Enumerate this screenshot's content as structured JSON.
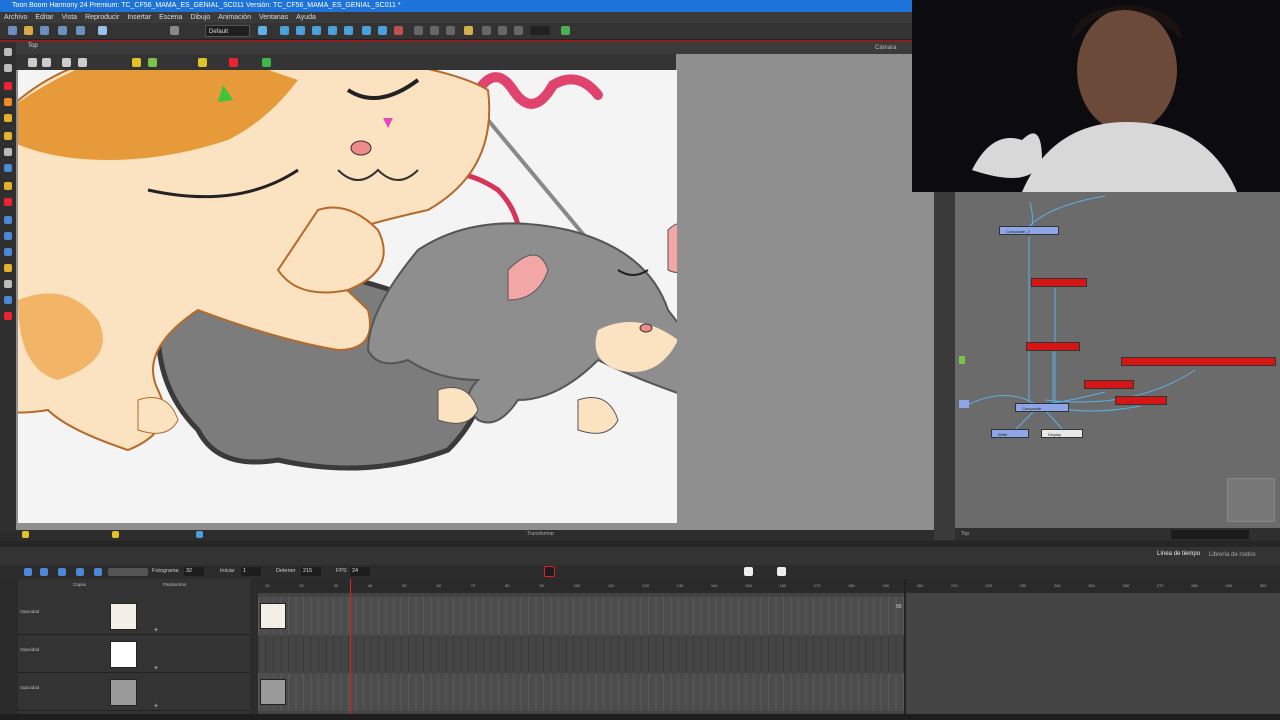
{
  "window": {
    "title": "Toon Boom Harmony 24 Premium: TC_CF56_MAMA_ES_GENIAL_SC011 Versión: TC_CF56_MAMA_ES_GENIAL_SC011 *"
  },
  "menu": [
    "Archivo",
    "Editar",
    "Vista",
    "Reproducir",
    "Insertar",
    "Escena",
    "Dibujo",
    "Animación",
    "Ventanas",
    "Ayuda"
  ],
  "toolbar": {
    "preset": "Default"
  },
  "viewport": {
    "tab": "Top",
    "camera_label": "Cámara",
    "status": "Transformar"
  },
  "nodes": {
    "composite_2": "Composite_2",
    "composite": "Composite",
    "write": "Write",
    "display": "Display"
  },
  "node_footer": "Top",
  "timeline": {
    "tab_timeline": "Línea de tiempo",
    "tab_nodelib": "Librería de nodos",
    "frames_label": "Fotograma",
    "frames_value": "32",
    "start_label": "Iniciar",
    "start_value": "1",
    "stop_label": "Detener",
    "stop_value": "215",
    "fps_label": "FPS",
    "fps_value": "24",
    "layers_header": "Capas",
    "params_header": "Parámetros",
    "opacity_label": "Opacidad",
    "ticks": [
      "10",
      "20",
      "30",
      "40",
      "50",
      "60",
      "70",
      "80",
      "90",
      "100",
      "110",
      "120",
      "130",
      "140",
      "150",
      "160",
      "170",
      "180",
      "190",
      "200",
      "210",
      "220",
      "230",
      "240",
      "250",
      "260",
      "270",
      "280",
      "290",
      "300"
    ],
    "end_marker": "90"
  },
  "colors": {
    "accent_blue": "#1e73d8",
    "node_red": "#d81515",
    "playhead": "#d22222"
  }
}
